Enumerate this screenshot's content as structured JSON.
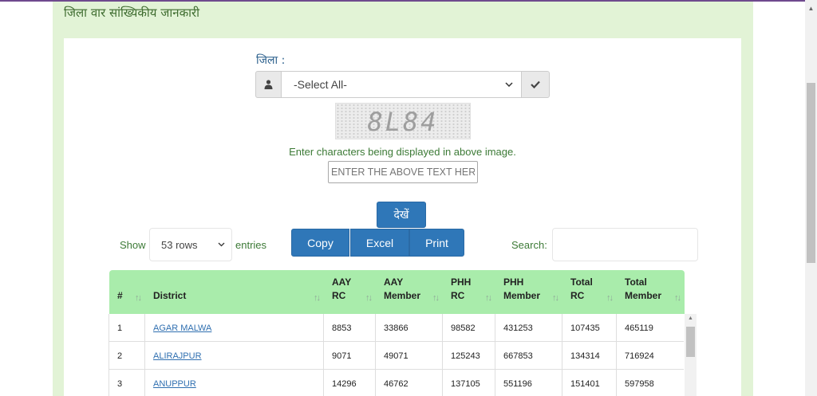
{
  "page": {
    "heading": "जिला वार सांख्यिकीय जानकारी"
  },
  "filter": {
    "district_label": "जिला :",
    "district_select_value": "-Select All-",
    "captcha_text": "8L84",
    "captcha_hint": "Enter characters being displayed in above image.",
    "captcha_placeholder": "ENTER THE ABOVE TEXT HERE",
    "view_button": "देखें"
  },
  "toolbar": {
    "copy": "Copy",
    "excel": "Excel",
    "print": "Print",
    "show_label": "Show",
    "rows_value": "53 rows",
    "entries_label": "entries",
    "search_label": "Search:"
  },
  "table": {
    "columns": [
      {
        "line1": "#",
        "line2": ""
      },
      {
        "line1": "District",
        "line2": ""
      },
      {
        "line1": "AAY",
        "line2": "RC"
      },
      {
        "line1": "AAY",
        "line2": "Member"
      },
      {
        "line1": "PHH",
        "line2": "RC"
      },
      {
        "line1": "PHH",
        "line2": "Member"
      },
      {
        "line1": "Total",
        "line2": "RC"
      },
      {
        "line1": "Total",
        "line2": "Member"
      }
    ],
    "rows": [
      [
        "1",
        "AGAR MALWA",
        "8853",
        "33866",
        "98582",
        "431253",
        "107435",
        "465119"
      ],
      [
        "2",
        "ALIRAJPUR",
        "9071",
        "49071",
        "125243",
        "667853",
        "134314",
        "716924"
      ],
      [
        "3",
        "ANUPPUR",
        "14296",
        "46762",
        "137105",
        "551196",
        "151401",
        "597958"
      ]
    ]
  }
}
